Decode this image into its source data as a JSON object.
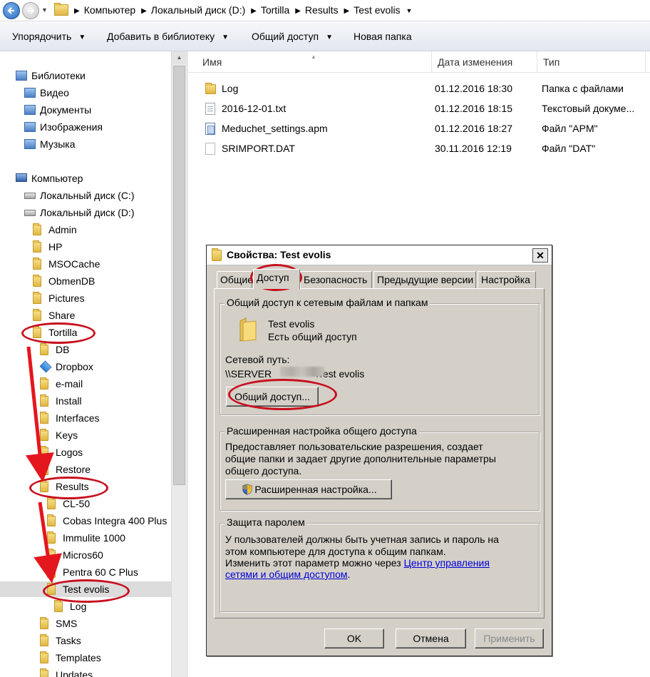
{
  "address": {
    "crumbs": [
      "Компьютер",
      "Локальный диск (D:)",
      "Tortilla",
      "Results",
      "Test evolis"
    ]
  },
  "toolbar": {
    "organize": "Упорядочить",
    "add_library": "Добавить в библиотеку",
    "share": "Общий доступ",
    "new_folder": "Новая папка"
  },
  "nav": {
    "libraries": "Библиотеки",
    "lib_video": "Видео",
    "lib_docs": "Документы",
    "lib_images": "Изображения",
    "lib_music": "Музыка",
    "computer": "Компьютер",
    "drive_c": "Локальный диск (C:)",
    "drive_d": "Локальный диск (D:)",
    "d_folders": [
      "Admin",
      "HP",
      "MSOCache",
      "ObmenDB",
      "Pictures",
      "Share",
      "Tortilla"
    ],
    "tortilla_folders": [
      "DB",
      "Dropbox",
      "e-mail",
      "Install",
      "Interfaces",
      "Keys",
      "Logos",
      "Restore",
      "Results"
    ],
    "results_folders": [
      "CL-50",
      "Cobas Integra 400 Plus",
      "Immulite 1000",
      "Micros60",
      "Pentra 60 C Plus",
      "Test evolis"
    ],
    "test_evolis_folders": [
      "Log"
    ],
    "tortilla_more": [
      "SMS",
      "Tasks",
      "Templates",
      "Updates"
    ]
  },
  "columns": {
    "name": "Имя",
    "date": "Дата изменения",
    "type": "Тип"
  },
  "files": [
    {
      "name": "Log",
      "date": "01.12.2016 18:30",
      "type": "Папка с файлами",
      "icon": "folder-icon"
    },
    {
      "name": "2016-12-01.txt",
      "date": "01.12.2016 18:15",
      "type": "Текстовый докуме...",
      "icon": "text-file-icon"
    },
    {
      "name": "Meduchet_settings.apm",
      "date": "01.12.2016 18:27",
      "type": "Файл \"APM\"",
      "icon": "apm-file-icon"
    },
    {
      "name": "SRIMPORT.DAT",
      "date": "30.11.2016 12:19",
      "type": "Файл \"DAT\"",
      "icon": "dat-file-icon"
    }
  ],
  "dialog": {
    "title": "Свойства: Test evolis",
    "tabs": [
      "Общие",
      "Доступ",
      "Безопасность",
      "Предыдущие версии",
      "Настройка"
    ],
    "active_tab": "Доступ",
    "share_group": "Общий доступ к сетевым файлам и папкам",
    "folder_name": "Test evolis",
    "share_status": "Есть общий доступ",
    "network_path_label": "Сетевой путь:",
    "network_path_prefix": "\\\\SERVER",
    "network_path_suffix": "\\Test evolis",
    "share_button": "Общий доступ...",
    "advanced_group": "Расширенная настройка общего доступа",
    "advanced_desc_1": "Предоставляет пользовательские разрешения, создает",
    "advanced_desc_2": "общие папки и задает другие дополнительные параметры",
    "advanced_desc_3": "общего доступа.",
    "advanced_button": "Расширенная настройка...",
    "password_group": "Защита паролем",
    "password_desc_1": "У пользователей должны быть учетная запись и пароль на",
    "password_desc_2": "этом компьютере для доступа к общим папкам.",
    "password_desc_3": "Изменить этот параметр можно через ",
    "password_link_1": "Центр управления",
    "password_link_2": "сетями и общим доступом",
    "password_desc_end": ".",
    "ok": "OK",
    "cancel": "Отмена",
    "apply": "Применить"
  },
  "colors": {
    "annotation": "#c8101e",
    "link": "#0000d8",
    "dialog_bg": "#d4d0c8"
  }
}
